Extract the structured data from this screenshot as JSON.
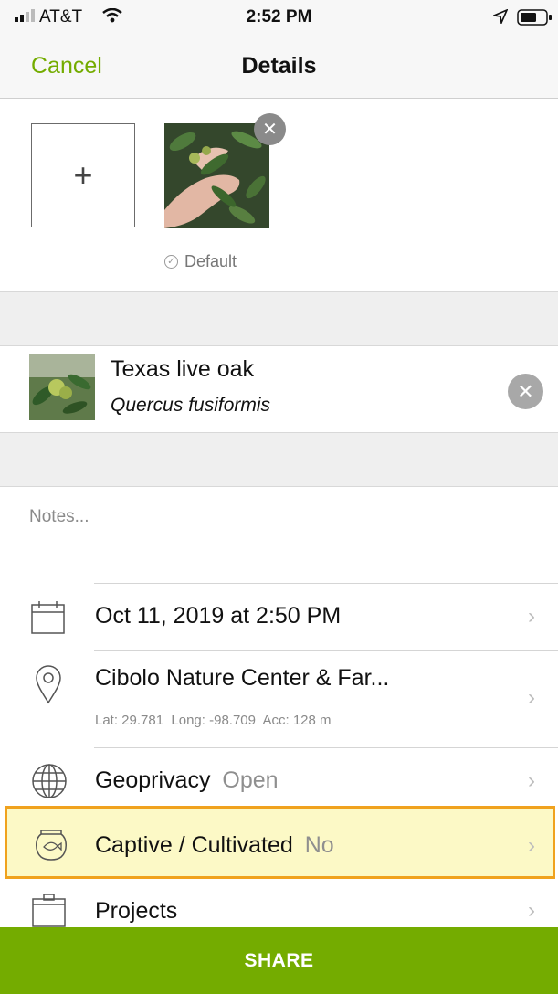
{
  "status_bar": {
    "carrier": "AT&T",
    "time": "2:52 PM"
  },
  "nav": {
    "cancel_label": "Cancel",
    "title": "Details"
  },
  "photos": {
    "add_label": "+",
    "default_label": "Default"
  },
  "taxon": {
    "common_name": "Texas live oak",
    "scientific_name": "Quercus fusiformis"
  },
  "notes": {
    "placeholder": "Notes..."
  },
  "rows": {
    "date": {
      "label": "Oct 11, 2019 at 2:50 PM",
      "icon": "calendar-icon"
    },
    "location": {
      "label": "Cibolo Nature Center & Far...",
      "coords": "Lat: 29.781  Long: -98.709  Acc: 128 m",
      "icon": "location-pin-icon"
    },
    "geoprivacy": {
      "label": "Geoprivacy",
      "value": "Open",
      "icon": "globe-icon"
    },
    "captive": {
      "label": "Captive / Cultivated",
      "value": "No",
      "icon": "fishbowl-icon",
      "highlight_color": "#f0a21e"
    },
    "projects": {
      "label": "Projects",
      "icon": "projects-icon"
    }
  },
  "share_label": "SHARE",
  "colors": {
    "accent": "#74ac00",
    "highlight_border": "#f0a21e",
    "highlight_fill": "#fcf9c6"
  }
}
